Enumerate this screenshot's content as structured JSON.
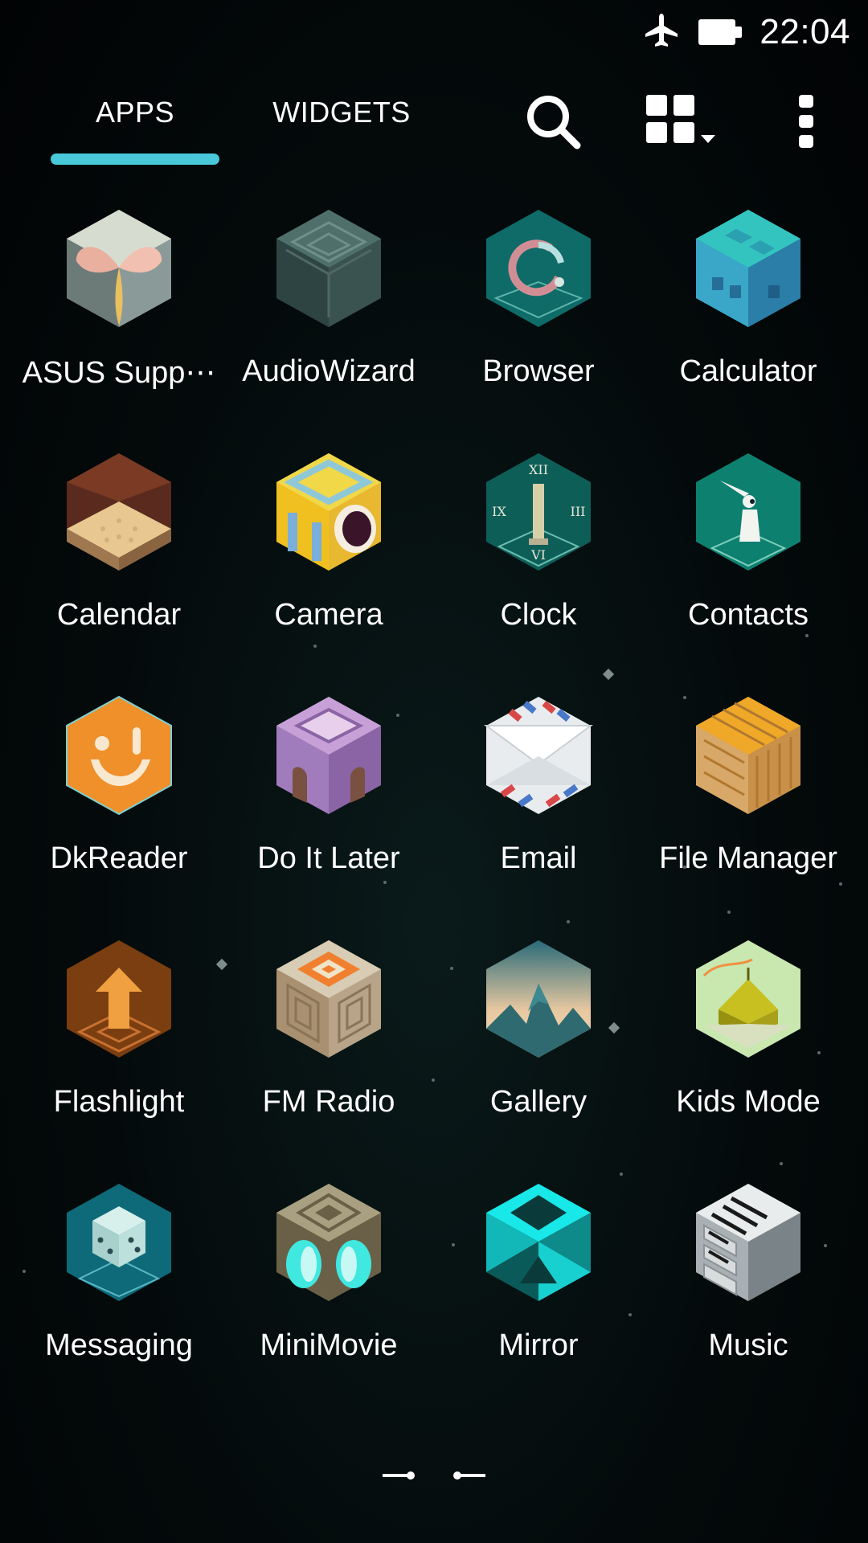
{
  "status_bar": {
    "time": "22:04",
    "icons": [
      "airplane-icon",
      "battery-icon"
    ]
  },
  "tabs": [
    {
      "label": "APPS",
      "selected": true
    },
    {
      "label": "WIDGETS",
      "selected": false
    }
  ],
  "toolbar": {
    "icons": [
      "search-icon",
      "grid-layout-icon",
      "more-vertical-icon"
    ],
    "accent_color": "#48c8d8"
  },
  "apps": [
    {
      "label": "ASUS Supp⋯",
      "icon": "asus-support-icon"
    },
    {
      "label": "AudioWizard",
      "icon": "audiowizard-icon"
    },
    {
      "label": "Browser",
      "icon": "browser-icon"
    },
    {
      "label": "Calculator",
      "icon": "calculator-icon"
    },
    {
      "label": "Calendar",
      "icon": "calendar-icon"
    },
    {
      "label": "Camera",
      "icon": "camera-icon"
    },
    {
      "label": "Clock",
      "icon": "clock-icon"
    },
    {
      "label": "Contacts",
      "icon": "contacts-icon"
    },
    {
      "label": "DkReader",
      "icon": "dkreader-icon"
    },
    {
      "label": "Do It Later",
      "icon": "do-it-later-icon"
    },
    {
      "label": "Email",
      "icon": "email-icon"
    },
    {
      "label": "File Manager",
      "icon": "file-manager-icon"
    },
    {
      "label": "Flashlight",
      "icon": "flashlight-icon"
    },
    {
      "label": "FM Radio",
      "icon": "fm-radio-icon"
    },
    {
      "label": "Gallery",
      "icon": "gallery-icon"
    },
    {
      "label": "Kids Mode",
      "icon": "kids-mode-icon"
    },
    {
      "label": "Messaging",
      "icon": "messaging-icon"
    },
    {
      "label": "MiniMovie",
      "icon": "minimovie-icon"
    },
    {
      "label": "Mirror",
      "icon": "mirror-icon"
    },
    {
      "label": "Music",
      "icon": "music-icon"
    }
  ],
  "pager": {
    "pages": 2,
    "current": 1
  }
}
